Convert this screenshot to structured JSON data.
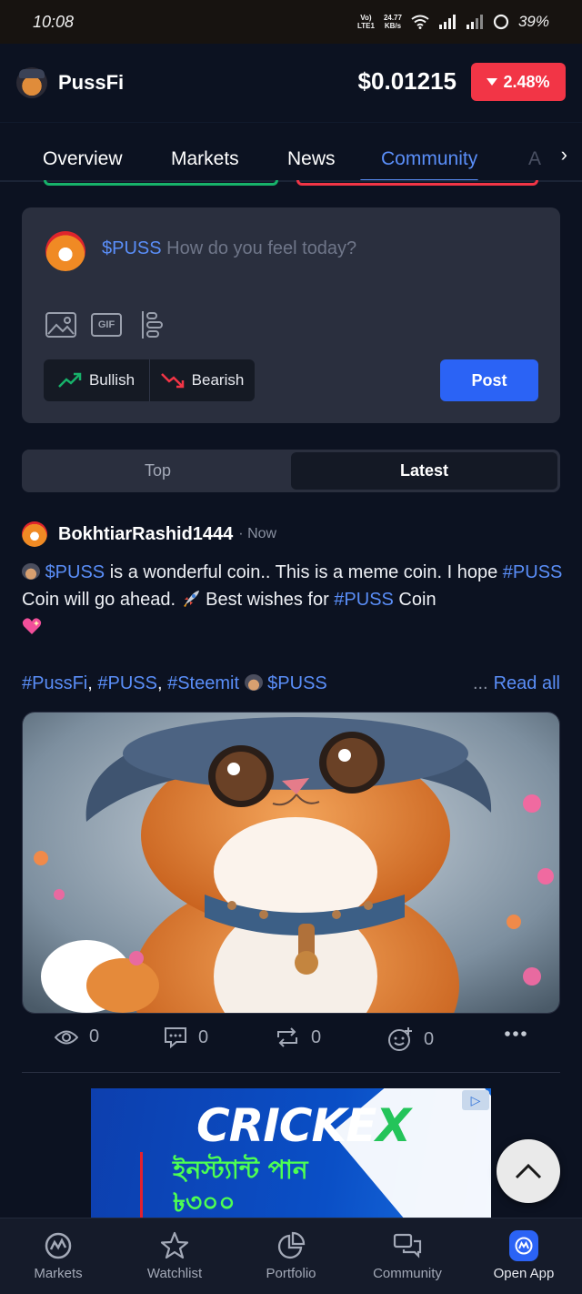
{
  "status_bar": {
    "time": "10:08",
    "network_top": "Vo)",
    "network_bottom": "LTE1",
    "speed_top": "24.77",
    "speed_bottom": "KB/s",
    "battery": "39%"
  },
  "header": {
    "app_name": "PussFi",
    "price": "$0.01215",
    "change": "2.48%",
    "change_color": "#f23546"
  },
  "tabs": [
    {
      "label": "Overview"
    },
    {
      "label": "Markets"
    },
    {
      "label": "News"
    },
    {
      "label": "Community",
      "active": true
    },
    {
      "label": "A"
    }
  ],
  "composer": {
    "ticker": "$PUSS",
    "placeholder": "How do you feel today?",
    "tools": [
      "image-icon",
      "gif-icon",
      "poll-icon"
    ],
    "gif_label": "GIF",
    "bullish_label": "Bullish",
    "bearish_label": "Bearish",
    "post_label": "Post"
  },
  "sort": {
    "options": [
      "Top",
      "Latest"
    ],
    "selected": "Latest"
  },
  "post": {
    "author": "BokhtiarRashid1444",
    "time": "· Now",
    "body": {
      "ticker": "$PUSS",
      "text1": " is a wonderful coin.. This is a meme coin. I hope ",
      "tag1": "#PUSS",
      "text2": " Coin will go ahead. ",
      "text3": " Best wishes for ",
      "tag2": "#PUSS",
      "text4": " Coin"
    },
    "tags": [
      "#PussFi",
      "#PUSS",
      "#Steemit"
    ],
    "tag_ticker": "$PUSS",
    "read_all_dots": "...",
    "read_all": "Read all",
    "stats": {
      "views": "0",
      "comments": "0",
      "reposts": "0",
      "reactions": "0"
    }
  },
  "ad": {
    "brand_main": "CRICKE",
    "brand_x": "X",
    "line1": "ইনস্ট্যান্ট পান",
    "line2": "৳৩০০",
    "choice": "▷"
  },
  "bottom_nav": [
    {
      "label": "Markets",
      "icon": "markets-icon"
    },
    {
      "label": "Watchlist",
      "icon": "star-icon"
    },
    {
      "label": "Portfolio",
      "icon": "pie-chart-icon"
    },
    {
      "label": "Community",
      "icon": "chat-icon"
    },
    {
      "label": "Open App",
      "icon": "open-app-icon"
    }
  ],
  "colors": {
    "accent": "#5a8ef8",
    "bullish": "#17b26a",
    "bearish": "#f23546",
    "post_button": "#2b63f5",
    "background": "#0c1221"
  }
}
